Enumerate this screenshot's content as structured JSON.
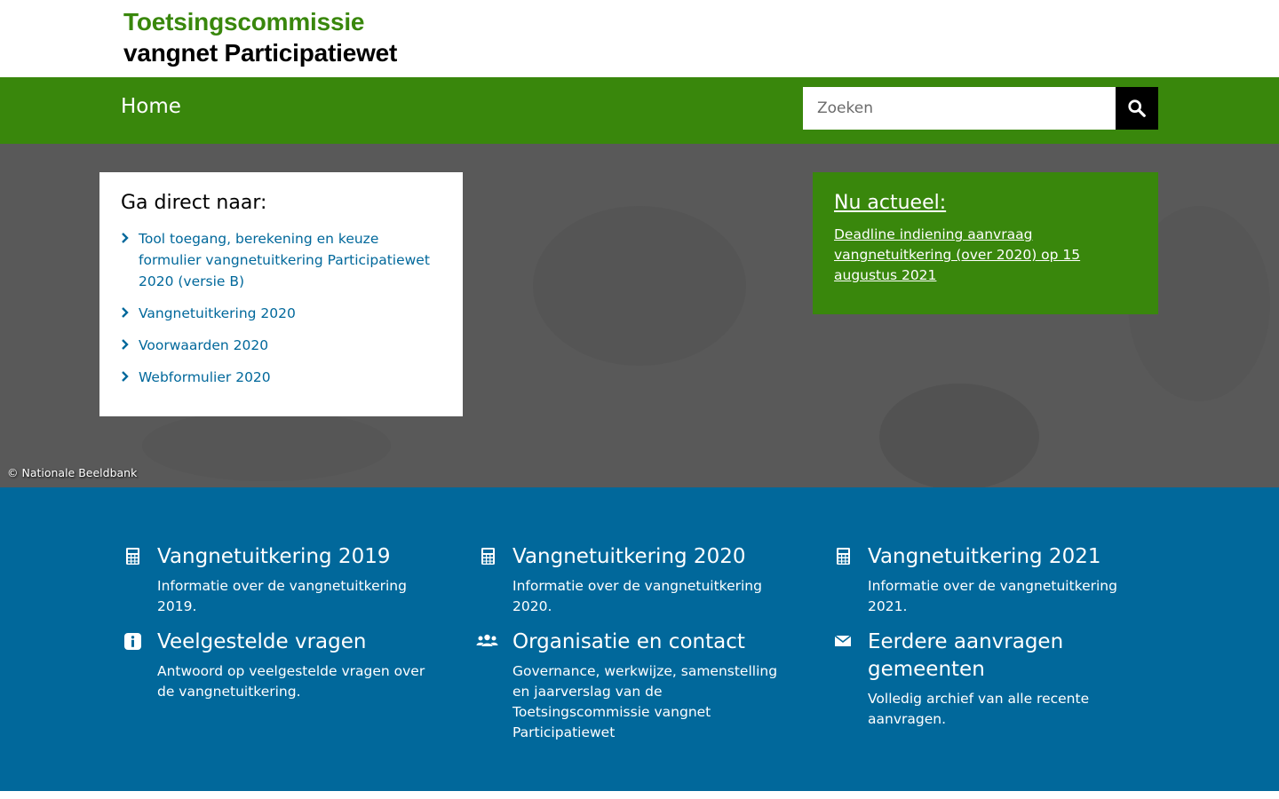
{
  "header": {
    "logo_line1": "Toetsingscommissie",
    "logo_line2": "vangnet Participatiewet"
  },
  "nav": {
    "home_label": "Home",
    "search_placeholder": "Zoeken"
  },
  "hero": {
    "goto": {
      "title": "Ga direct naar:",
      "items": [
        {
          "label": "Tool toegang, berekening en keuze formulier vangnetuitkering Participatiewet 2020 (versie B)"
        },
        {
          "label": "Vangnetuitkering 2020"
        },
        {
          "label": "Voorwaarden 2020"
        },
        {
          "label": "Webformulier 2020"
        }
      ]
    },
    "actueel": {
      "title": "Nu actueel:",
      "link": "Deadline indiening aanvraag vangnetuitkering (over 2020) op 15 augustus 2021"
    },
    "copyright": "© Nationale Beeldbank"
  },
  "tiles": [
    {
      "icon": "calculator-icon",
      "title": "Vangnetuitkering 2019",
      "desc": "Informatie over de vangnetuitkering 2019."
    },
    {
      "icon": "calculator-icon",
      "title": "Vangnetuitkering 2020",
      "desc": "Informatie over de vangnetuitkering 2020."
    },
    {
      "icon": "calculator-icon",
      "title": "Vangnetuitkering 2021",
      "desc": "Informatie over de vangnetuitkering 2021."
    },
    {
      "icon": "info-icon",
      "title": "Veelgestelde vragen",
      "desc": "Antwoord op veelgestelde vragen over de vangnetuitkering."
    },
    {
      "icon": "people-icon",
      "title": "Organisatie en contact",
      "desc": "Governance, werkwijze, samenstelling en jaarverslag van de Toetsingscommissie vangnet Participatiewet"
    },
    {
      "icon": "envelope-icon",
      "title": "Eerdere aanvragen gemeenten",
      "desc": "Volledig archief van alle recente aanvragen."
    }
  ],
  "colors": {
    "brand_green": "#39870c",
    "brand_blue": "#01689b",
    "hero_gray": "#595959",
    "link_blue": "#01689b"
  }
}
